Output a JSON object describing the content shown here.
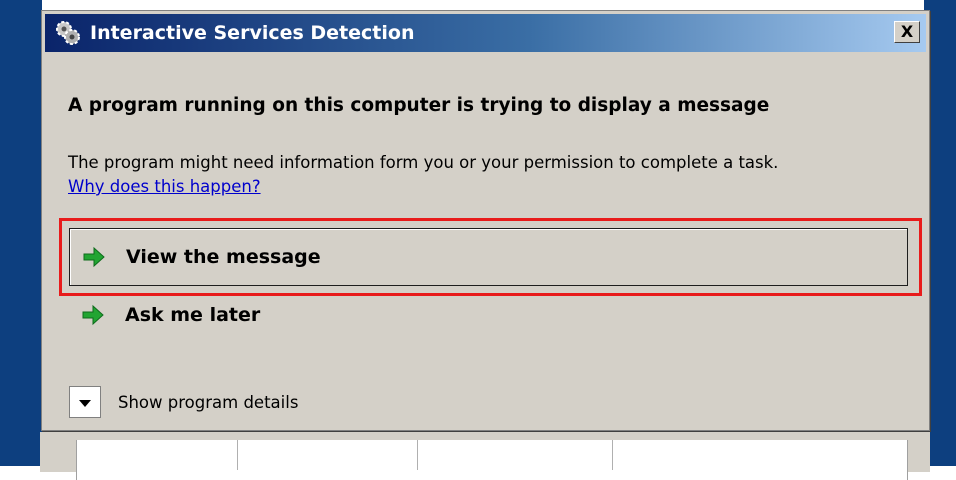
{
  "window": {
    "title": "Interactive Services Detection",
    "close_label": "X"
  },
  "content": {
    "heading": "A program running on this computer is trying to display a message",
    "description": "The program might need information form you or your permission to complete a task.",
    "help_link": "Why does this happen?"
  },
  "options": [
    {
      "label": "View the message",
      "icon": "green-arrow-icon",
      "highlighted": true
    },
    {
      "label": "Ask me later",
      "icon": "green-arrow-icon",
      "highlighted": false
    }
  ],
  "details": {
    "label": "Show program details",
    "icon": "chevron-down-icon"
  },
  "colors": {
    "titlebar_start": "#0a246a",
    "titlebar_end": "#a6caf0",
    "dialog_bg": "#d4d0c8",
    "highlight_border": "#e81b1b",
    "link": "#0000cc",
    "arrow": "#22a532",
    "desktop": "#0d3f7f"
  }
}
